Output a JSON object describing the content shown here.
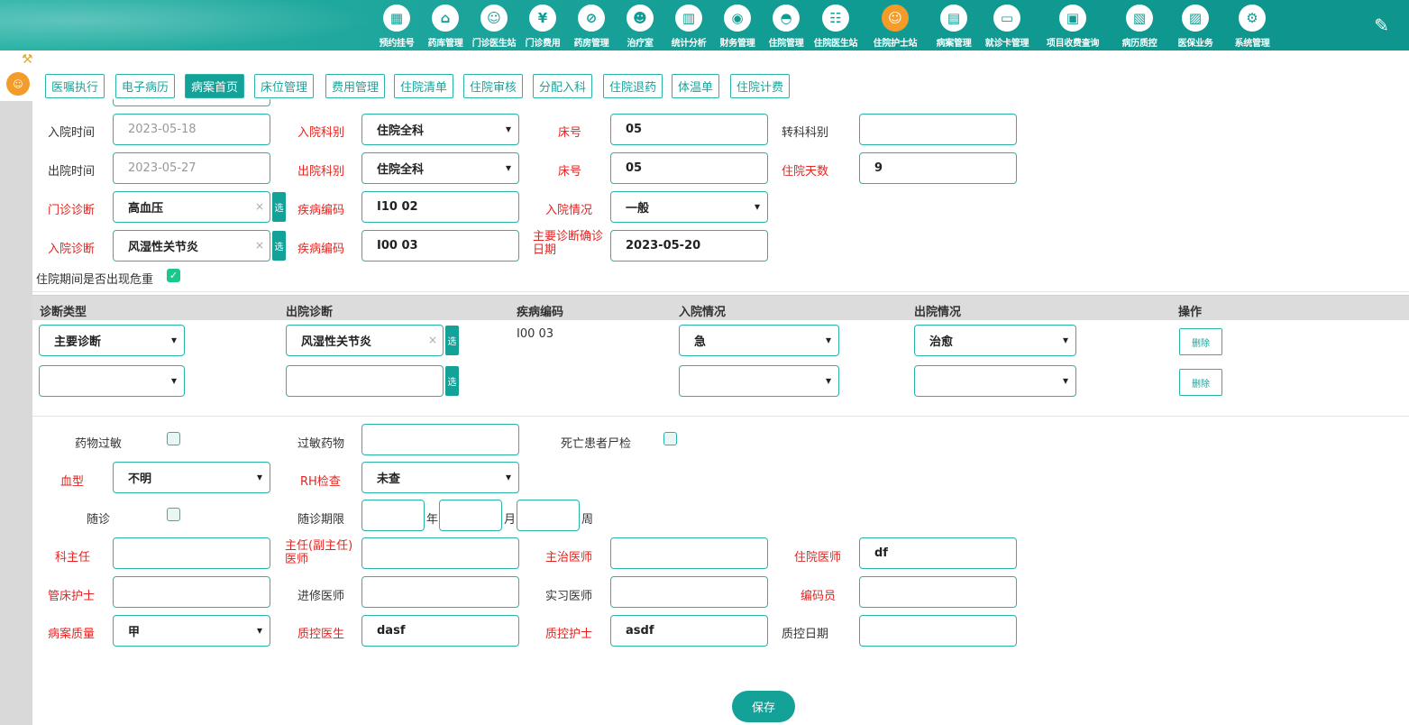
{
  "nav": {
    "items": [
      {
        "label": "预约挂号",
        "icon": "calendar-icon",
        "glyph": "▦"
      },
      {
        "label": "药库管理",
        "icon": "pharmacy-warehouse-icon",
        "glyph": "⌂"
      },
      {
        "label": "门诊医生站",
        "icon": "outpatient-doctor-icon",
        "glyph": "☺"
      },
      {
        "label": "门诊费用",
        "icon": "yen-icon",
        "glyph": "¥"
      },
      {
        "label": "药房管理",
        "icon": "pill-icon",
        "glyph": "⊘"
      },
      {
        "label": "治疗室",
        "icon": "nurse-icon",
        "glyph": "☻"
      },
      {
        "label": "统计分析",
        "icon": "bar-chart-icon",
        "glyph": "▥"
      },
      {
        "label": "财务管理",
        "icon": "coins-icon",
        "glyph": "◉"
      },
      {
        "label": "住院管理",
        "icon": "bed-icon",
        "glyph": "◓"
      },
      {
        "label": "住院医生站",
        "icon": "inpatient-doctor-icon",
        "glyph": "☷"
      },
      {
        "label": "住院护士站",
        "icon": "inpatient-nurse-icon",
        "glyph": "☺"
      },
      {
        "label": "病案管理",
        "icon": "medical-record-icon",
        "glyph": "▤"
      },
      {
        "label": "就诊卡管理",
        "icon": "card-icon",
        "glyph": "▭"
      },
      {
        "label": "项目收费查询",
        "icon": "fee-query-icon",
        "glyph": "▣"
      },
      {
        "label": "病历质控",
        "icon": "quality-control-icon",
        "glyph": "▧"
      },
      {
        "label": "医保业务",
        "icon": "insurance-icon",
        "glyph": "▨"
      },
      {
        "label": "系统管理",
        "icon": "gear-icon",
        "glyph": "⚙"
      }
    ],
    "active_index": 10
  },
  "tabs": [
    "医嘱执行",
    "电子病历",
    "病案首页",
    "床位管理",
    "费用管理",
    "住院清单",
    "住院审核",
    "分配入科",
    "住院退药",
    "体温单",
    "住院计费"
  ],
  "active_tab_index": 2,
  "admission": {
    "admit_time_label": "入院时间",
    "admit_time": "2023-05-18",
    "admit_dept_label": "入院科别",
    "admit_dept": "住院全科",
    "bed_label": "床号",
    "admit_bed": "05",
    "transfer_dept_label": "转科科别",
    "transfer_dept": "",
    "discharge_time_label": "出院时间",
    "discharge_time": "2023-05-27",
    "discharge_dept_label": "出院科别",
    "discharge_dept": "住院全科",
    "discharge_bed": "05",
    "stay_days_label": "住院天数",
    "stay_days": "9",
    "outpatient_diag_label": "门诊诊断",
    "outpatient_diag": "高血压",
    "disease_code_label": "疾病编码",
    "outpatient_code": "I10 02",
    "admit_condition_label": "入院情况",
    "admit_condition": "一般",
    "admit_diag_label": "入院诊断",
    "admit_diag": "风湿性关节炎",
    "admit_code": "I00 03",
    "confirm_date_label": "主要诊断确诊日期",
    "confirm_date": "2023-05-20",
    "critical_label": "住院期间是否出现危重",
    "pick_label": "选"
  },
  "diagnosis_table": {
    "headers": [
      "诊断类型",
      "出院诊断",
      "疾病编码",
      "入院情况",
      "出院情况",
      "操作"
    ],
    "rows": [
      {
        "type": "主要诊断",
        "diagnosis": "风湿性关节炎",
        "code": "I00 03",
        "admit": "急",
        "discharge": "治愈",
        "action": "删除"
      },
      {
        "type": "",
        "diagnosis": "",
        "code": "",
        "admit": "",
        "discharge": "",
        "action": "删除"
      }
    ]
  },
  "extra": {
    "drug_allergy_label": "药物过敏",
    "allergy_drug_label": "过敏药物",
    "allergy_drug": "",
    "autopsy_label": "死亡患者尸检",
    "blood_type_label": "血型",
    "blood_type": "不明",
    "rh_label": "RH检查",
    "rh": "未查",
    "followup_label": "随诊",
    "followup_period_label": "随诊期限",
    "unit_year": "年",
    "unit_month": "月",
    "unit_week": "周"
  },
  "staff": {
    "director_label": "科主任",
    "director": "",
    "chief_label": "主任(副主任)医师",
    "chief": "",
    "attending_label": "主治医师",
    "attending": "",
    "resident_label": "住院医师",
    "resident": "df",
    "bed_nurse_label": "管床护士",
    "bed_nurse": "",
    "trainee_label": "进修医师",
    "trainee": "",
    "intern_label": "实习医师",
    "intern": "",
    "coder_label": "编码员",
    "coder": "",
    "quality_label": "病案质量",
    "quality": "甲",
    "qc_doctor_label": "质控医生",
    "qc_doctor": "dasf",
    "qc_nurse_label": "质控护士",
    "qc_nurse": "asdf",
    "qc_date_label": "质控日期",
    "qc_date": ""
  },
  "save_label": "保存"
}
